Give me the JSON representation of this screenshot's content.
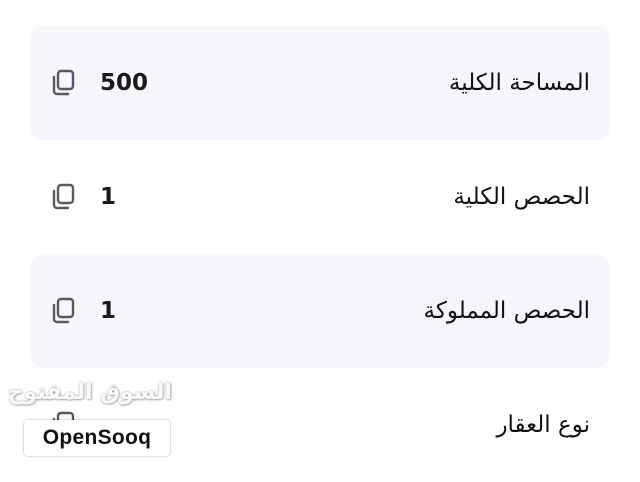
{
  "rows": [
    {
      "label": "المساحة الكلية",
      "value": "500",
      "copy_icon": "copy-icon"
    },
    {
      "label": "الحصص الكلية",
      "value": "1",
      "copy_icon": "copy-icon"
    },
    {
      "label": "الحصص المملوكة",
      "value": "1",
      "copy_icon": "copy-icon"
    },
    {
      "label": "نوع العقار",
      "value": "",
      "copy_icon": "copy-icon"
    }
  ],
  "watermark": {
    "arabic": "السوق المفتوح",
    "latin": "OpenSooq"
  },
  "colors": {
    "row_shaded_bg": "#f6f7fb",
    "text": "#111111",
    "icon": "#555555"
  }
}
